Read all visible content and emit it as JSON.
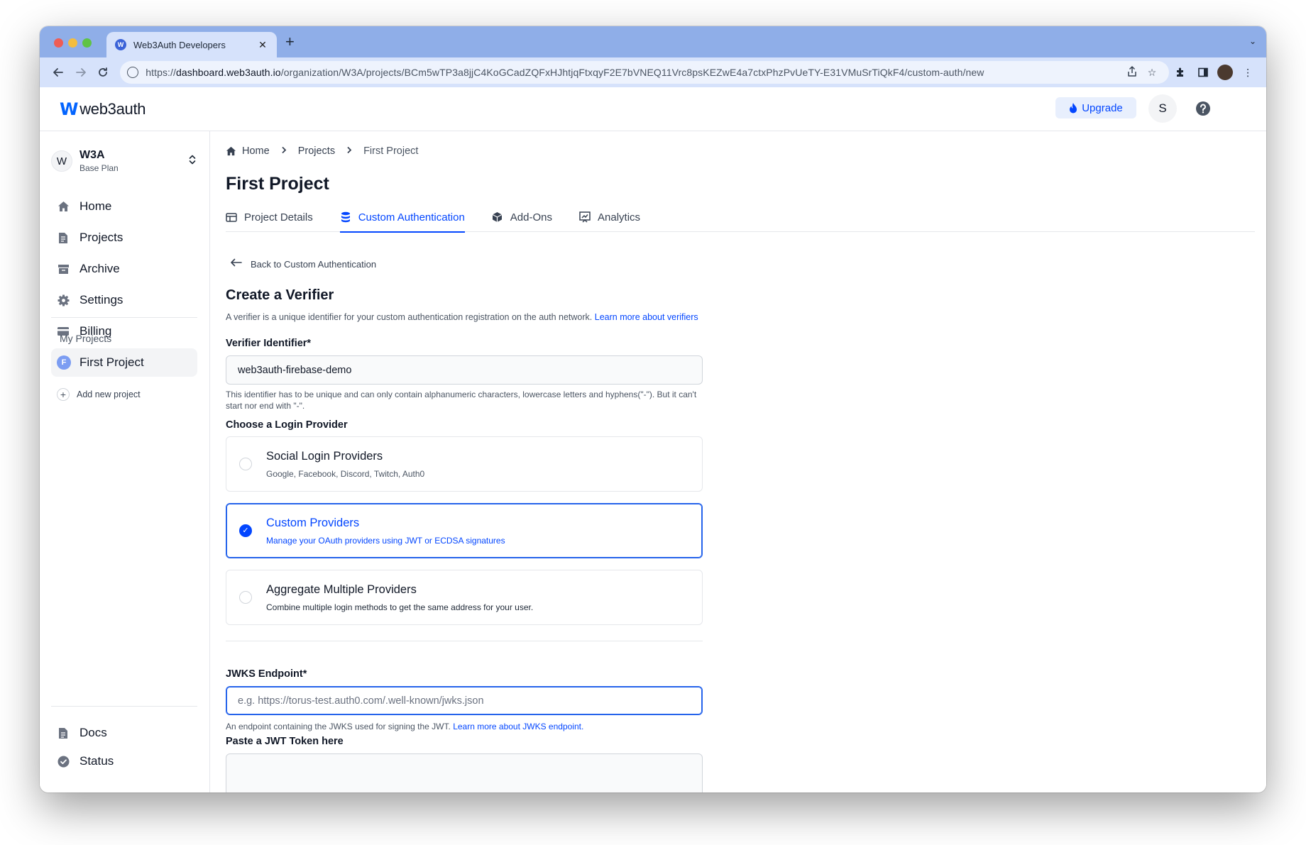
{
  "browser": {
    "tab_title": "Web3Auth Developers",
    "tab_favicon_letter": "W",
    "url_scheme": "https://",
    "url_host": "dashboard.web3auth.io",
    "url_path": "/organization/W3A/projects/BCm5wTP3a8jjC4KoGCadZQFxHJhtjqFtxqyF2E7bVNEQ11Vrc8psKEZwE4a7ctxPhzPvUeTY-E31VMuSrTiQkF4/custom-auth/new"
  },
  "header": {
    "logo_text": "web3auth",
    "upgrade_label": "Upgrade",
    "avatar_letter": "S"
  },
  "sidebar": {
    "org_initial": "W",
    "org_name": "W3A",
    "org_plan": "Base Plan",
    "items": [
      {
        "label": "Home"
      },
      {
        "label": "Projects"
      },
      {
        "label": "Archive"
      },
      {
        "label": "Settings"
      },
      {
        "label": "Billing"
      }
    ],
    "my_projects_heading": "My Projects",
    "project_badge": "F",
    "project_name": "First Project",
    "add_project_label": "Add new project",
    "bottom_items": [
      {
        "label": "Docs"
      },
      {
        "label": "Status"
      }
    ]
  },
  "main": {
    "breadcrumb": [
      "Home",
      "Projects",
      "First Project"
    ],
    "title": "First Project",
    "tabs": [
      {
        "label": "Project Details",
        "active": false
      },
      {
        "label": "Custom Authentication",
        "active": true
      },
      {
        "label": "Add-Ons",
        "active": false
      },
      {
        "label": "Analytics",
        "active": false
      }
    ],
    "back_label": "Back to Custom Authentication",
    "section_title": "Create a Verifier",
    "section_desc": "A verifier is a unique identifier for your custom authentication registration on the auth network.",
    "section_desc_link": "Learn more about verifiers",
    "verifier_label": "Verifier Identifier*",
    "verifier_value": "web3auth-firebase-demo",
    "verifier_help": "This identifier has to be unique and can only contain alphanumeric characters, lowercase letters and hyphens(\"-\"). But it can't start nor end with \"-\".",
    "provider_label": "Choose a Login Provider",
    "providers": [
      {
        "title": "Social Login Providers",
        "subtitle": "Google, Facebook, Discord, Twitch, Auth0",
        "selected": false
      },
      {
        "title": "Custom Providers",
        "subtitle": "Manage your OAuth providers using JWT or ECDSA signatures",
        "selected": true
      },
      {
        "title": "Aggregate Multiple Providers",
        "subtitle": "Combine multiple login methods to get the same address for your user.",
        "selected": false
      }
    ],
    "jwks_label": "JWKS Endpoint*",
    "jwks_placeholder": "e.g. https://torus-test.auth0.com/.well-known/jwks.json",
    "jwks_help": "An endpoint containing the JWKS used for signing the JWT.",
    "jwks_help_link": "Learn more about JWKS endpoint.",
    "jwt_label": "Paste a JWT Token here"
  },
  "colors": {
    "accent": "#0346ff",
    "browser_chrome": "#8faee8",
    "browser_toolbar": "#d6e2fb"
  }
}
